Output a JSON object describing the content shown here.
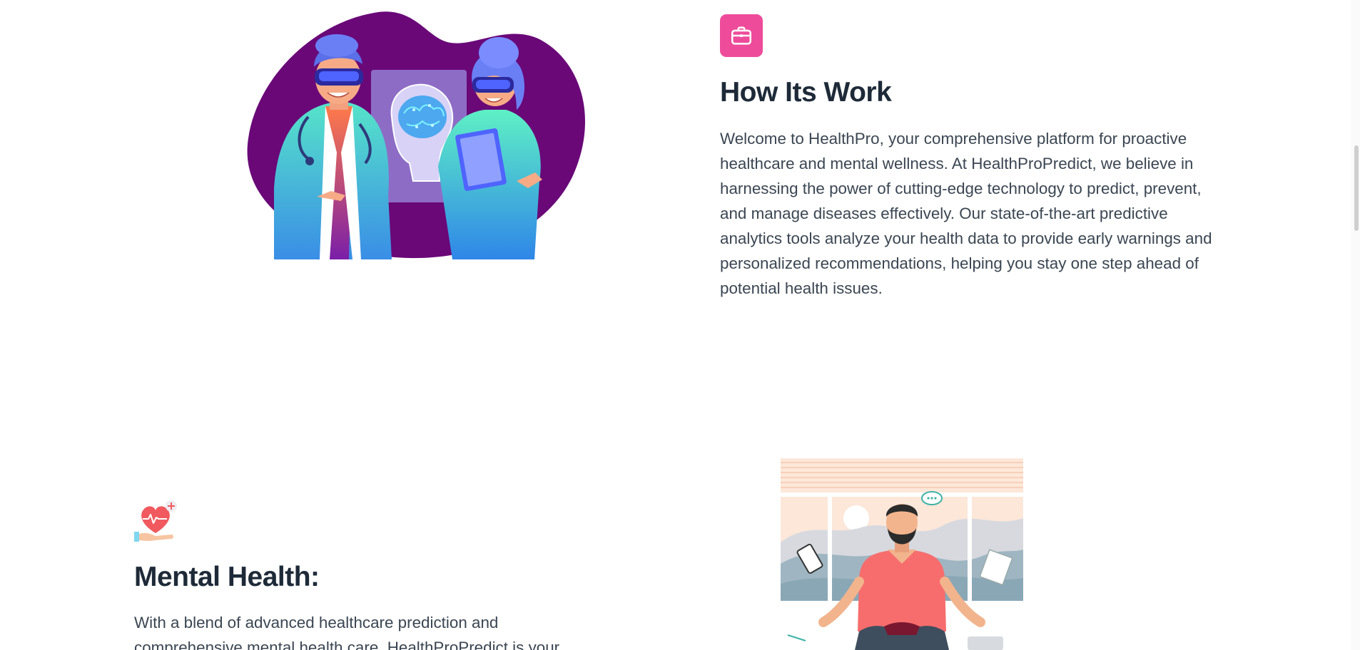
{
  "how_it_works": {
    "title": "How Its Work",
    "paragraph": "Welcome to HealthPro, your comprehensive platform for proactive healthcare and mental wellness. At HealthProPredict, we believe in harnessing the power of cutting-edge technology to predict, prevent, and manage diseases effectively. Our state-of-the-art predictive analytics tools analyze your health data to provide early warnings and personalized recommendations, helping you stay one step ahead of potential health issues.",
    "icon": "briefcase-icon",
    "icon_bg_color": "#ee4c9b",
    "illustration": "doctors-brain-scan-illustration"
  },
  "mental_health": {
    "title": "Mental Health:",
    "paragraph": "With a blend of advanced healthcare prediction and comprehensive mental health care, HealthProPredict is your",
    "icon": "heart-in-hand-icon",
    "illustration": "meditation-illustration"
  },
  "colors": {
    "heading": "#1e2a38",
    "body_text": "#3b4652",
    "accent_purple": "#6a0f7a",
    "accent_pink": "#ee4c9b"
  }
}
